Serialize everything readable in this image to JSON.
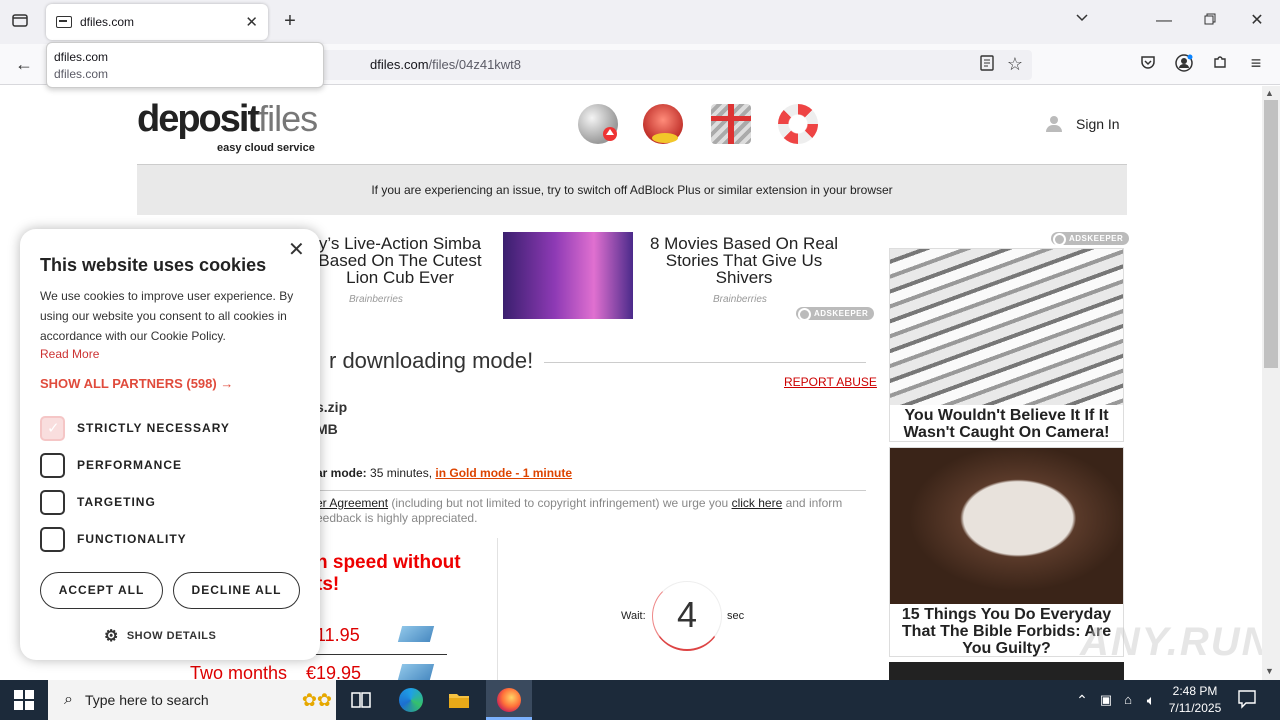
{
  "browser": {
    "tab_title": "dfiles.com",
    "url_host": "dfiles.com",
    "url_path": "/files/04z41kwt8",
    "popup_title": "dfiles.com",
    "popup_url": "dfiles.com"
  },
  "site": {
    "logo_main": "deposit",
    "logo_files": "files",
    "logo_tagline": "easy cloud service",
    "sign_in": "Sign In",
    "notice": "If you are experiencing an issue, try to switch off AdBlock Plus or similar extension in your browser"
  },
  "ads": {
    "left_text": "y’s Live-Action Simba\nBased On The Cutest\nLion Cub Ever",
    "left_brand": "Brainberries",
    "mid_text": "8 Movies Based On Real\nStories That Give Us\nShivers",
    "mid_brand": "Brainberries",
    "adskeeper": "ADSKEEPER",
    "right1_caption": "You Wouldn't Believe It If It Wasn't Caught On Camera!",
    "right2_caption": "15 Things You Do Everyday That The Bible Forbids: Are You Guilty?"
  },
  "download": {
    "heading": "r downloading mode!",
    "report_abuse": "REPORT ABUSE",
    "file_name": "s.zip",
    "file_size": "MB",
    "mode_label": "ar mode:",
    "mode_time": " 35 minutes, ",
    "gold_mode": "in Gold mode - 1 minute",
    "agree_link": "er Agreement",
    "agree_text1": " (including but not limited to copyright infringement) we urge you ",
    "click_here": "click here",
    "agree_text2": " and inform",
    "agree_text3": "eedback is highly appreciated.",
    "speed_line1": "n speed without",
    "speed_line2": "ts!",
    "price1": "11.95",
    "price2_label": "Two months",
    "price2": "€19.95",
    "wait_label": "Wait:",
    "wait_value": "4",
    "sec_label": "sec"
  },
  "cookie": {
    "title": "This website uses cookies",
    "description": "We use cookies to improve user experience. By using our website you consent to all cookies in accordance with our Cookie Policy.",
    "read_more": "Read More",
    "show_partners": "SHOW ALL PARTNERS (598) →",
    "options": [
      {
        "label": "STRICTLY NECESSARY",
        "checked": true
      },
      {
        "label": "PERFORMANCE",
        "checked": false
      },
      {
        "label": "TARGETING",
        "checked": false
      },
      {
        "label": "FUNCTIONALITY",
        "checked": false
      }
    ],
    "accept_all": "ACCEPT ALL",
    "decline_all": "DECLINE ALL",
    "show_details": "SHOW DETAILS"
  },
  "taskbar": {
    "search_placeholder": "Type here to search",
    "time": "2:48 PM",
    "date": "7/11/2025"
  },
  "watermark": "ANY.RUN",
  "colors": {
    "accent_red": "#e04b3c",
    "gold_link": "#d40",
    "taskbar_bg": "#1c2a3a"
  }
}
